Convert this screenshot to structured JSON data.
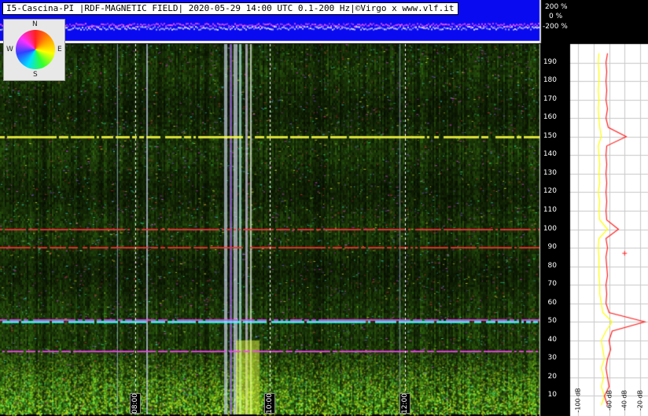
{
  "header": {
    "title": "I5-Cascina-PI |RDF-MAGNETIC FIELD| 2020-05-29 14:00 UTC 0.1-200 Hz|©Virgo x www.vlf.it",
    "strip_scale": [
      "200 %",
      "0 %",
      "-200 %"
    ]
  },
  "compass": {
    "n": "N",
    "s": "S",
    "e": "E",
    "w": "W"
  },
  "chart_data": {
    "type": "heatmap",
    "title": "I5-Cascina-PI |RDF-MAGNETIC FIELD| 2020-05-29 14:00 UTC 0.1-200 Hz|©Virgo x www.vlf.it",
    "xlabel": "",
    "ylabel": "",
    "x_range_utc": [
      "06:00",
      "14:00"
    ],
    "x_ticks": [
      "08:00",
      "10:00",
      "12:00"
    ],
    "y_range_hz": [
      0,
      200
    ],
    "y_ticks": [
      10,
      20,
      30,
      40,
      50,
      60,
      70,
      80,
      90,
      100,
      110,
      120,
      130,
      140,
      150,
      160,
      170,
      180,
      190
    ],
    "persistent_lines_hz": [
      {
        "hz": 150,
        "color": "#ffff40"
      },
      {
        "hz": 100,
        "color": "#ff3040"
      },
      {
        "hz": 90,
        "color": "#ff3030"
      },
      {
        "hz": 50,
        "color": "#40ffff"
      },
      {
        "hz": 51,
        "color": "#ff40ff"
      },
      {
        "hz": 34,
        "color": "#ff40ff"
      }
    ],
    "grid": true,
    "spectrum": {
      "type": "line",
      "x_ticks": [
        "-100 dB",
        "-60 dB",
        "-40 dB",
        "-20 dB"
      ],
      "x_range_db": [
        -110,
        -10
      ],
      "series": [
        {
          "color": "#ffff00",
          "points": [
            [
              -70,
              5
            ],
            [
              -66,
              10
            ],
            [
              -70,
              15
            ],
            [
              -67,
              20
            ],
            [
              -70,
              25
            ],
            [
              -66,
              30
            ],
            [
              -68,
              35
            ],
            [
              -70,
              40
            ],
            [
              -64,
              45
            ],
            [
              -56,
              50
            ],
            [
              -68,
              55
            ],
            [
              -70,
              60
            ],
            [
              -72,
              65
            ],
            [
              -72,
              70
            ],
            [
              -73,
              75
            ],
            [
              -73,
              80
            ],
            [
              -73,
              85
            ],
            [
              -74,
              90
            ],
            [
              -73,
              95
            ],
            [
              -62,
              100
            ],
            [
              -72,
              105
            ],
            [
              -73,
              110
            ],
            [
              -72,
              115
            ],
            [
              -74,
              120
            ],
            [
              -72,
              125
            ],
            [
              -73,
              130
            ],
            [
              -72,
              135
            ],
            [
              -73,
              140
            ],
            [
              -74,
              145
            ],
            [
              -70,
              150
            ],
            [
              -72,
              155
            ],
            [
              -73,
              160
            ],
            [
              -74,
              165
            ],
            [
              -73,
              170
            ],
            [
              -74,
              175
            ],
            [
              -73,
              180
            ],
            [
              -73,
              185
            ],
            [
              -74,
              190
            ],
            [
              -73,
              195
            ]
          ]
        },
        {
          "color": "#ff2020",
          "points": [
            [
              -62,
              5
            ],
            [
              -66,
              10
            ],
            [
              -60,
              15
            ],
            [
              -62,
              20
            ],
            [
              -64,
              25
            ],
            [
              -62,
              30
            ],
            [
              -58,
              35
            ],
            [
              -60,
              40
            ],
            [
              -56,
              45
            ],
            [
              -14,
              50
            ],
            [
              -60,
              55
            ],
            [
              -64,
              60
            ],
            [
              -63,
              65
            ],
            [
              -64,
              70
            ],
            [
              -62,
              75
            ],
            [
              -63,
              80
            ],
            [
              -64,
              85
            ],
            [
              -62,
              90
            ],
            [
              -64,
              95
            ],
            [
              -48,
              100
            ],
            [
              -63,
              105
            ],
            [
              -64,
              110
            ],
            [
              -63,
              115
            ],
            [
              -64,
              120
            ],
            [
              -63,
              125
            ],
            [
              -64,
              130
            ],
            [
              -63,
              135
            ],
            [
              -64,
              140
            ],
            [
              -63,
              145
            ],
            [
              -38,
              150
            ],
            [
              -61,
              155
            ],
            [
              -64,
              160
            ],
            [
              -62,
              165
            ],
            [
              -64,
              170
            ],
            [
              -63,
              175
            ],
            [
              -64,
              180
            ],
            [
              -63,
              185
            ],
            [
              -64,
              190
            ],
            [
              -62,
              195
            ]
          ]
        }
      ]
    }
  }
}
